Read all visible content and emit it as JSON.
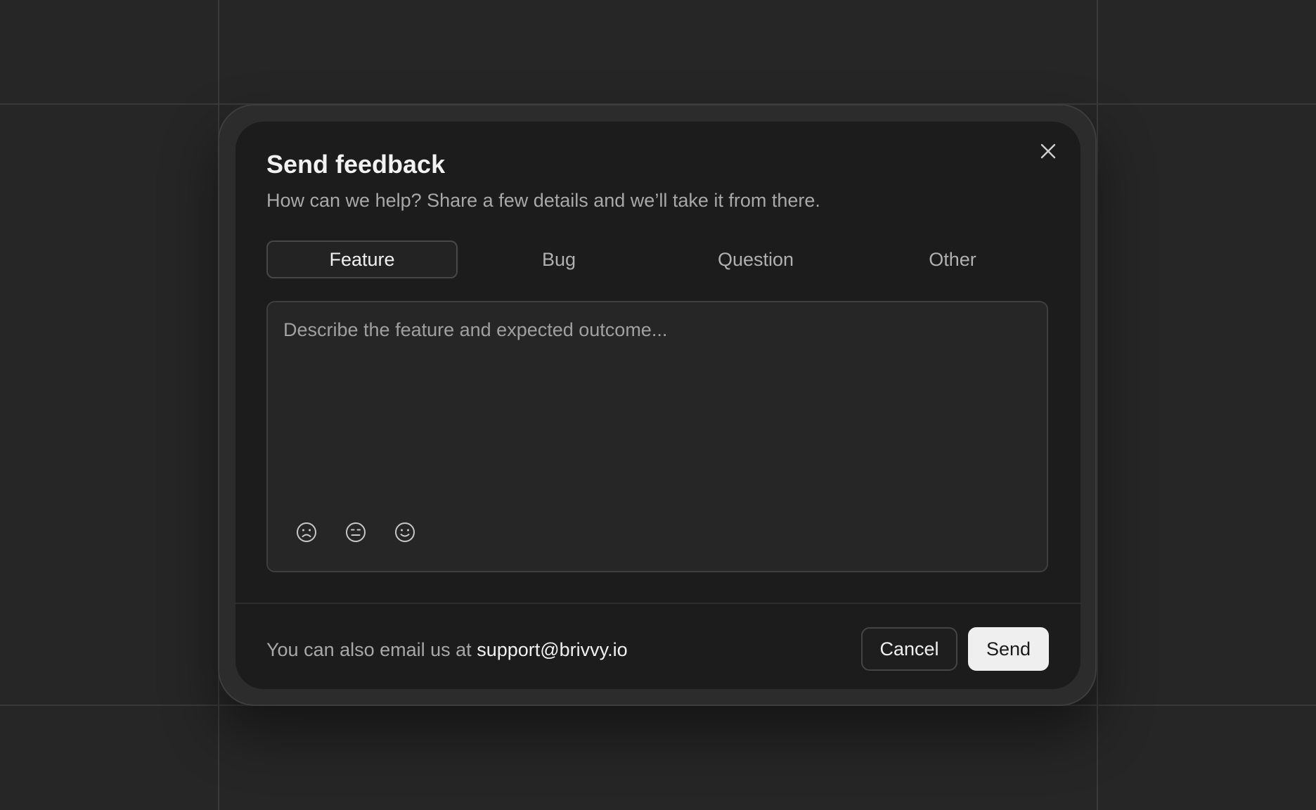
{
  "dialog": {
    "title": "Send feedback",
    "subtitle": "How can we help? Share a few details and we’ll take it from there.",
    "close_icon": "close-icon"
  },
  "tabs": [
    {
      "label": "Feature",
      "active": true
    },
    {
      "label": "Bug",
      "active": false
    },
    {
      "label": "Question",
      "active": false
    },
    {
      "label": "Other",
      "active": false
    }
  ],
  "feedback_input": {
    "value": "",
    "placeholder": "Describe the feature and expected outcome..."
  },
  "moods": [
    {
      "icon": "sad-face-icon"
    },
    {
      "icon": "neutral-face-icon"
    },
    {
      "icon": "happy-face-icon"
    }
  ],
  "footer": {
    "prefix": "You can also email us at",
    "email": "support@brivvy.io",
    "cancel_label": "Cancel",
    "send_label": "Send"
  },
  "colors": {
    "background": "#262626",
    "dialog": "#1c1c1c",
    "send_button": "#efefef"
  }
}
